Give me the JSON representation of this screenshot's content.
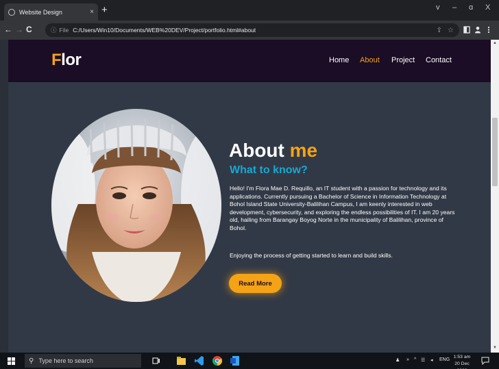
{
  "browser": {
    "tab_title": "Website Design",
    "tab_close": "×",
    "new_tab": "+",
    "window_controls": [
      "v",
      "–",
      "ɑ",
      "X"
    ],
    "file_label": "File",
    "url": "C:/Users/Win10/Documents/WEB%20DEV/Project/portfolio.html#about"
  },
  "site": {
    "logo_first": "F",
    "logo_rest": "lor",
    "nav": [
      {
        "label": "Home"
      },
      {
        "label": "About"
      },
      {
        "label": "Project"
      },
      {
        "label": "Contact"
      }
    ],
    "active_nav": "About"
  },
  "about": {
    "heading_plain": "About",
    "heading_accent": "me",
    "subheading": "What to know?",
    "paragraph_1": "Hello! I'm Flora Mae D. Requillo, an IT student with a passion for technology and its applications. Currently pursuing a Bachelor of Science in Information Technology at Bohol Island State University-Balilihan Campus, I am keenly interested in web development, cybersecurity, and exploring the endless possibilities of IT. I am 20 years old, hailing from Barangay Boyog Norte in the municipality of Balilihan, province of Bohol.",
    "paragraph_2": "Enjoying the process of getting started to learn and build skills.",
    "button_label": "Read More"
  },
  "taskbar": {
    "search_placeholder": "Type here to search",
    "language": "ENG",
    "time": "1:53 am",
    "date": "20 Dec 2023"
  },
  "colors": {
    "accent": "#f4a316",
    "subheading": "#15a9d4",
    "nav_bg": "#1b0d26",
    "page_bg": "#323946"
  }
}
